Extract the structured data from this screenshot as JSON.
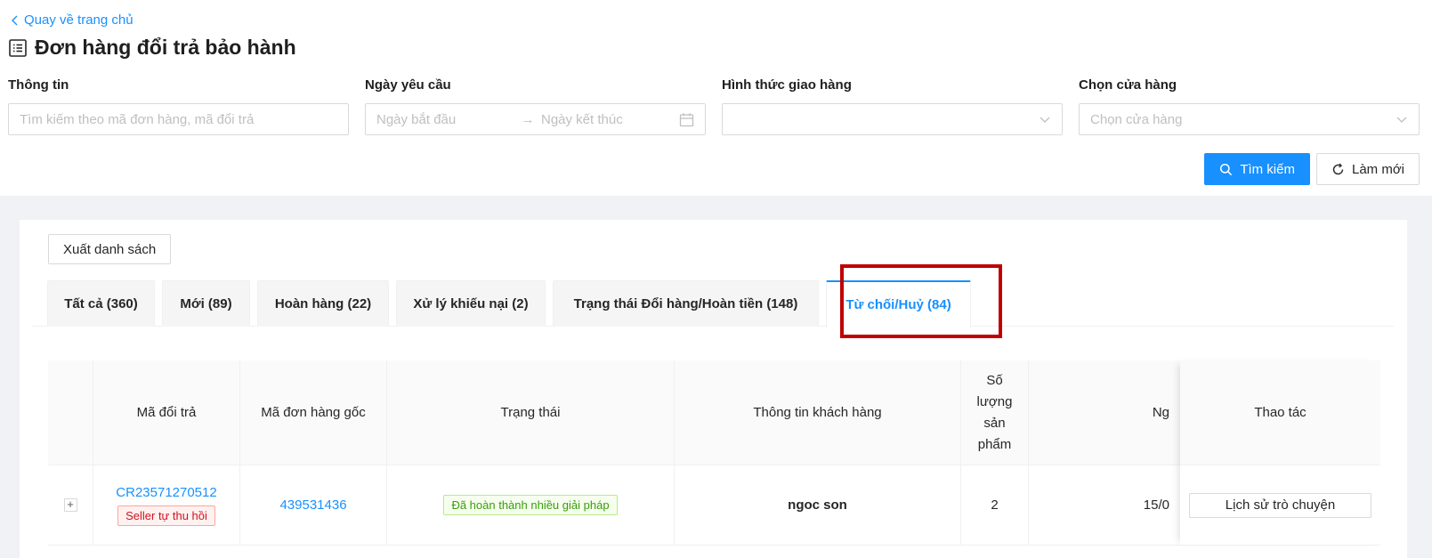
{
  "nav": {
    "back_label": "Quay về trang chủ"
  },
  "page": {
    "title": "Đơn hàng đổi trả bảo hành"
  },
  "filters": {
    "info_label": "Thông tin",
    "info_placeholder": "Tìm kiếm theo mã đơn hàng, mã đổi trả",
    "date_label": "Ngày yêu cầu",
    "date_start_placeholder": "Ngày bắt đầu",
    "date_end_placeholder": "Ngày kết thúc",
    "shipping_label": "Hình thức giao hàng",
    "shipping_value": "",
    "store_label": "Chọn cửa hàng",
    "store_placeholder": "Chọn cửa hàng"
  },
  "actions": {
    "search_label": "Tìm kiếm",
    "reset_label": "Làm mới"
  },
  "export_label": "Xuất danh sách",
  "tabs": [
    {
      "label": "Tất cả (360)"
    },
    {
      "label": "Mới (89)"
    },
    {
      "label": "Hoàn hàng (22)"
    },
    {
      "label": "Xử lý khiếu nại (2)"
    },
    {
      "label": "Trạng thái Đổi hàng/Hoàn tiền (148)"
    },
    {
      "label": "Từ chối/Huỷ (84)"
    }
  ],
  "table": {
    "headers": {
      "return_code": "Mã đổi trả",
      "order_code": "Mã đơn hàng gốc",
      "status": "Trạng thái",
      "customer": "Thông tin khách hàng",
      "qty": "Số lượng sản phẩm",
      "date": "Ng",
      "actions": "Thao tác"
    },
    "rows": [
      {
        "return_code": "CR23571270512",
        "return_tag": "Seller tự thu hồi",
        "order_code": "439531436",
        "status": "Đã hoàn thành nhiều giải pháp",
        "customer": "ngoc son",
        "qty": "2",
        "date": "15/0",
        "action_label": "Lịch sử trò chuyện"
      }
    ]
  },
  "colors": {
    "accent": "#1890ff",
    "highlight": "#c00000"
  }
}
